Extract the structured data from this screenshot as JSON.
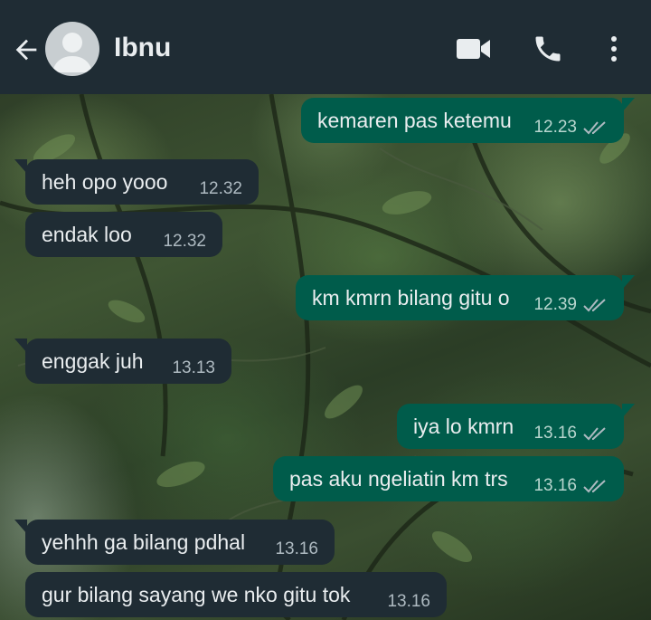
{
  "header": {
    "contact_name": "Ibnu",
    "icons": [
      "back-arrow-icon",
      "avatar",
      "video-call-icon",
      "phone-icon",
      "more-menu-icon"
    ]
  },
  "messages": [
    {
      "direction": "out",
      "text": "kemaren pas ketemu",
      "time": "12.23",
      "status": "read"
    },
    {
      "direction": "in",
      "text": "heh opo yooo",
      "time": "12.32"
    },
    {
      "direction": "in",
      "text": "endak loo",
      "time": "12.32"
    },
    {
      "direction": "out",
      "text": "km kmrn bilang gitu o",
      "time": "12.39",
      "status": "read"
    },
    {
      "direction": "in",
      "text": "enggak juh",
      "time": "13.13"
    },
    {
      "direction": "out",
      "text": "iya lo kmrn",
      "time": "13.16",
      "status": "read"
    },
    {
      "direction": "out",
      "text": "pas aku ngeliatin km trs",
      "time": "13.16",
      "status": "read"
    },
    {
      "direction": "in",
      "text": "yehhh ga bilang pdhal",
      "time": "13.16"
    },
    {
      "direction": "in",
      "text": "gur bilang sayang we nko gitu tok",
      "time": "13.16"
    }
  ],
  "colors": {
    "header_bg": "#1f2c34",
    "incoming_bubble": "#1f2c34",
    "outgoing_bubble": "#005c4b",
    "text": "#e9edef"
  }
}
